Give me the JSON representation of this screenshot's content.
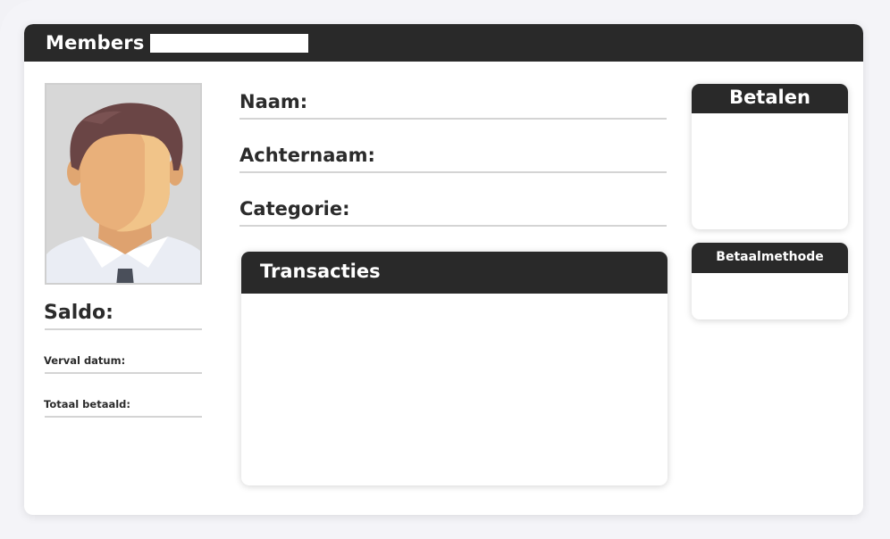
{
  "window": {
    "title": "Members",
    "search_value": ""
  },
  "profile": {
    "saldo_label": "Saldo:",
    "verval_label": "Verval datum:",
    "totaal_label": "Totaal betaald:"
  },
  "form": {
    "naam_label": "Naam:",
    "achternaam_label": "Achternaam:",
    "categorie_label": "Categorie:"
  },
  "panels": {
    "transacties_title": "Transacties",
    "betalen_title": "Betalen",
    "betaalmethode_title": "Betaalmethode"
  },
  "colors": {
    "header_bg": "#292929",
    "background": "#f2f2f6",
    "divider": "#d4d4d4"
  }
}
